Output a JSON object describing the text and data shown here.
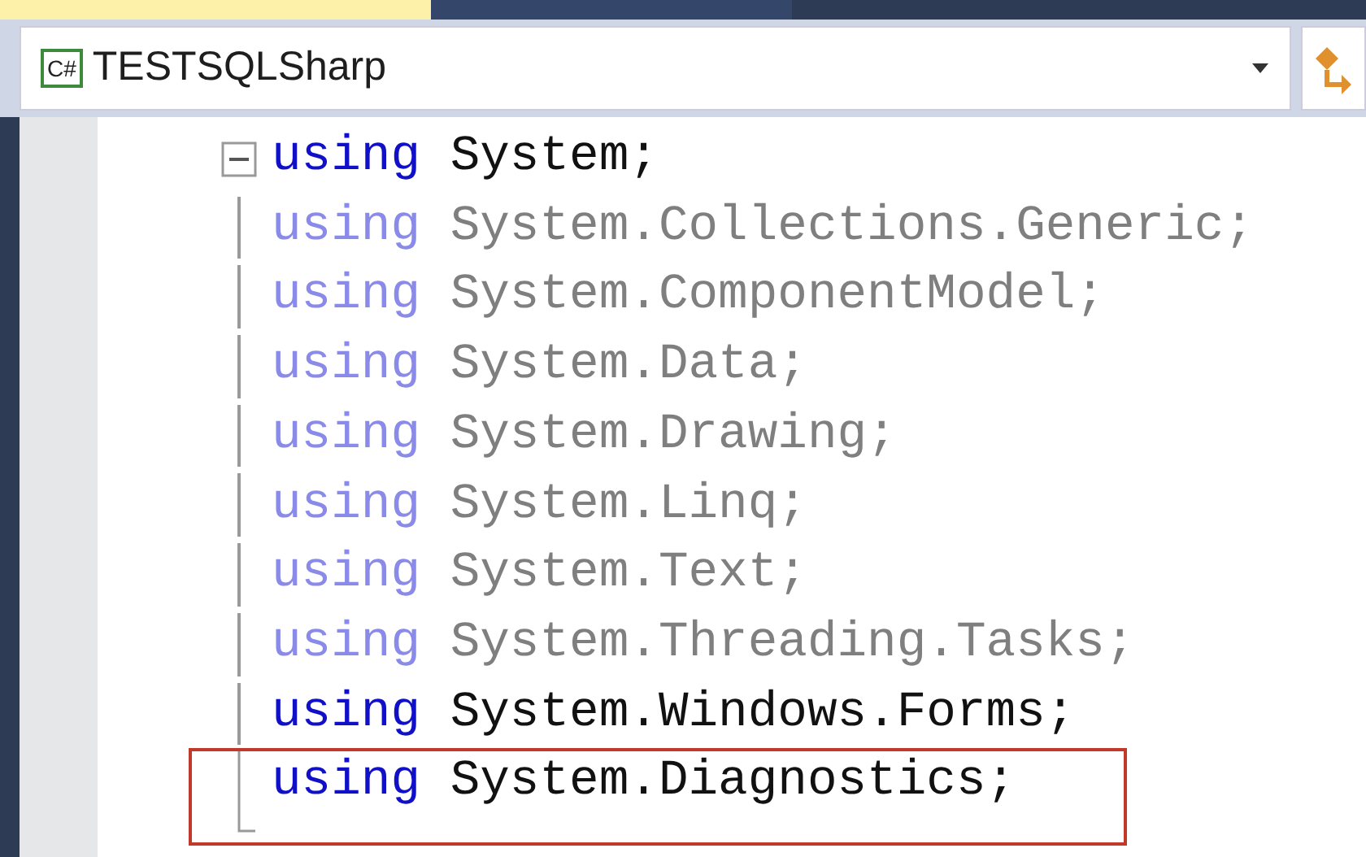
{
  "navigation_bar": {
    "language_badge": "C#",
    "project": "TESTSQLSharp"
  },
  "lines": [
    {
      "keyword": "using",
      "text": "System;",
      "dimmed": false,
      "highlighted": false
    },
    {
      "keyword": "using",
      "text": "System.Collections.Generic;",
      "dimmed": true,
      "highlighted": false
    },
    {
      "keyword": "using",
      "text": "System.ComponentModel;",
      "dimmed": true,
      "highlighted": false
    },
    {
      "keyword": "using",
      "text": "System.Data;",
      "dimmed": true,
      "highlighted": false
    },
    {
      "keyword": "using",
      "text": "System.Drawing;",
      "dimmed": true,
      "highlighted": false
    },
    {
      "keyword": "using",
      "text": "System.Linq;",
      "dimmed": true,
      "highlighted": false
    },
    {
      "keyword": "using",
      "text": "System.Text;",
      "dimmed": true,
      "highlighted": false
    },
    {
      "keyword": "using",
      "text": "System.Threading.Tasks;",
      "dimmed": true,
      "highlighted": false
    },
    {
      "keyword": "using",
      "text": "System.Windows.Forms;",
      "dimmed": false,
      "highlighted": false
    },
    {
      "keyword": "using",
      "text": "System.Diagnostics;",
      "dimmed": false,
      "highlighted": true
    }
  ]
}
